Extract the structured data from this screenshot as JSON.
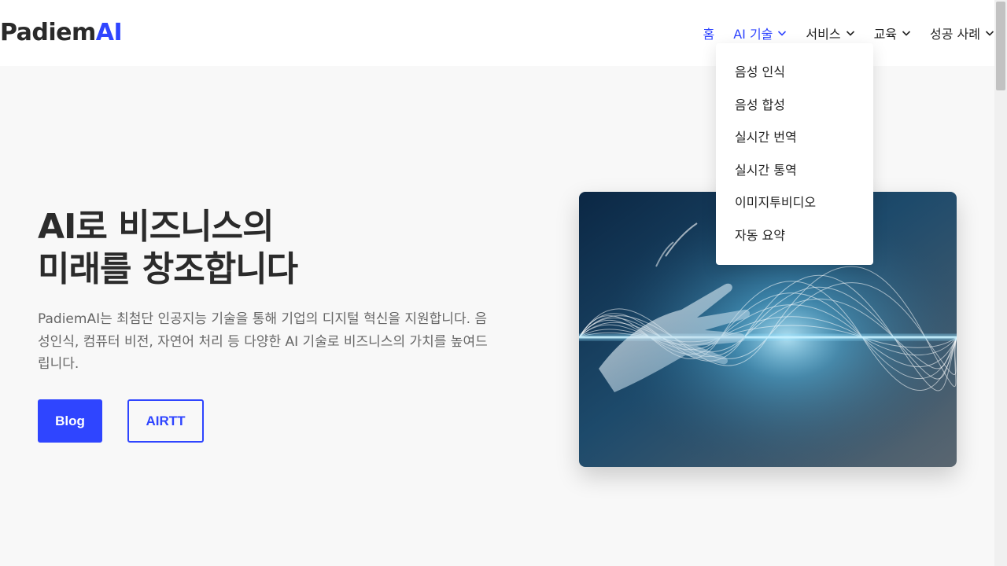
{
  "header": {
    "logo_main": "Padiem",
    "logo_accent": "AI"
  },
  "nav": {
    "items": [
      {
        "label": "홈",
        "active": true,
        "dropdown": false
      },
      {
        "label": "AI 기술",
        "active": true,
        "dropdown": true
      },
      {
        "label": "서비스",
        "active": false,
        "dropdown": true
      },
      {
        "label": "교육",
        "active": false,
        "dropdown": true
      },
      {
        "label": "성공 사례",
        "active": false,
        "dropdown": true
      }
    ],
    "open_dropdown": {
      "parent": "AI 기술",
      "items": [
        "음성 인식",
        "음성 합성",
        "실시간 번역",
        "실시간 통역",
        "이미지투비디오",
        "자동 요약"
      ]
    }
  },
  "hero": {
    "title_line1": "AI로 비즈니스의",
    "title_line2": "미래를 창조합니다",
    "description": "PadiemAI는 최첨단 인공지능 기술을 통해 기업의 디지털 혁신을 지원합니다. 음성인식, 컴퓨터 비전, 자연어 처리 등 다양한 AI 기술로 비즈니스의 가치를 높여드립니다.",
    "primary_button": "Blog",
    "secondary_button": "AIRTT"
  },
  "colors": {
    "accent": "#2f45ff",
    "text": "#222222",
    "muted": "#666666",
    "background": "#f8f8f8"
  },
  "icons": {
    "nav_chevron": "chevron-down-icon"
  }
}
